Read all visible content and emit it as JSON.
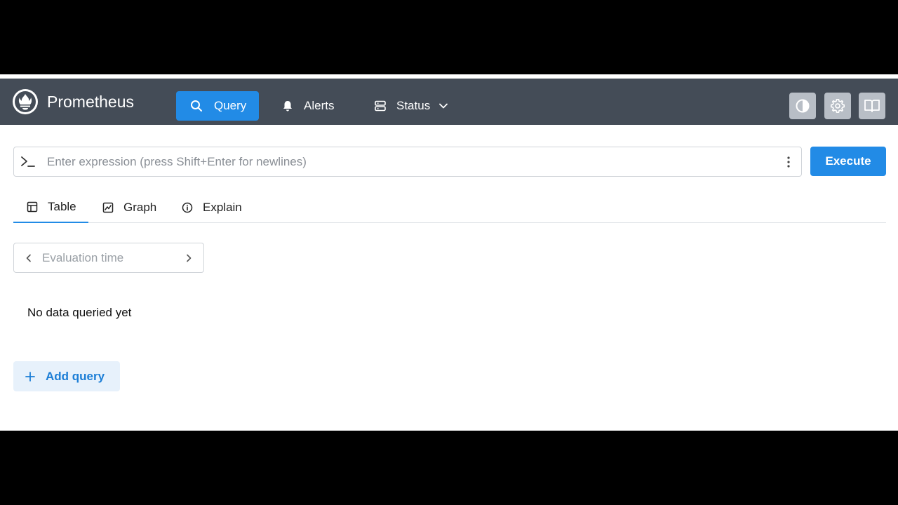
{
  "navbar": {
    "brand": "Prometheus",
    "items": [
      {
        "label": "Query",
        "icon": "search-icon",
        "active": true
      },
      {
        "label": "Alerts",
        "icon": "bell-icon",
        "active": false
      },
      {
        "label": "Status",
        "icon": "server-icon",
        "active": false,
        "has_dropdown": true
      }
    ],
    "right_buttons": [
      "theme-toggle-icon",
      "gear-icon",
      "book-icon"
    ]
  },
  "query": {
    "placeholder": "Enter expression (press Shift+Enter for newlines)",
    "value": "",
    "execute_label": "Execute"
  },
  "tabs": [
    {
      "label": "Table",
      "icon": "table-icon",
      "active": true
    },
    {
      "label": "Graph",
      "icon": "chart-icon",
      "active": false
    },
    {
      "label": "Explain",
      "icon": "info-icon",
      "active": false
    }
  ],
  "eval_time": {
    "placeholder": "Evaluation time",
    "value": ""
  },
  "result": {
    "empty_text": "No data queried yet"
  },
  "add_query_label": "Add query",
  "colors": {
    "navbar_bg": "#444c57",
    "accent": "#228be6",
    "add_query_bg": "#e7f1fb"
  }
}
